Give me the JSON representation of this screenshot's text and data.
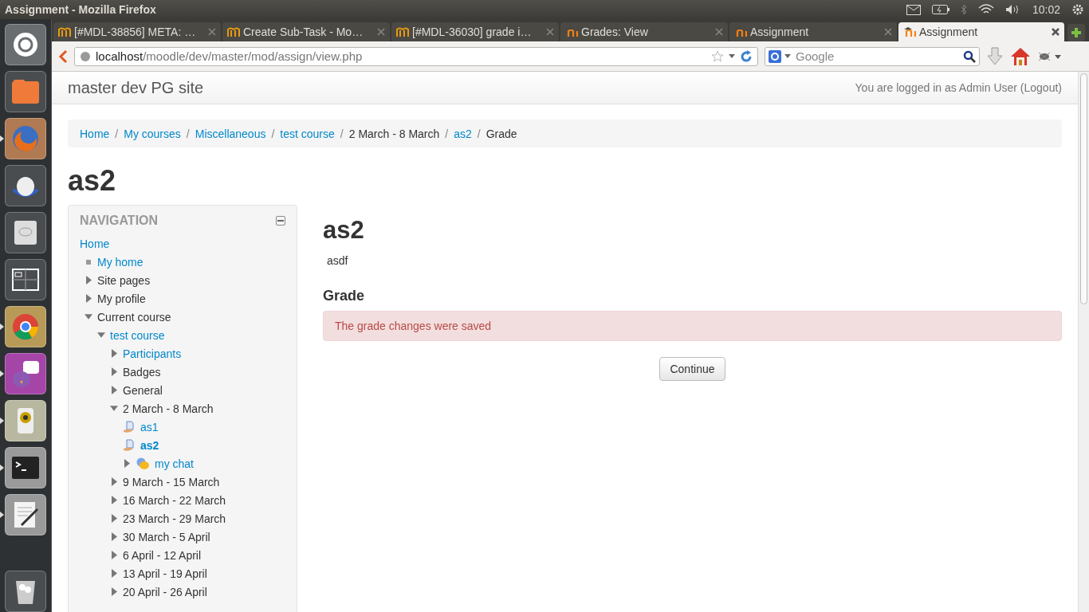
{
  "top_panel": {
    "title": "Assignment - Mozilla Firefox",
    "clock": "10:02"
  },
  "launcher": [
    {
      "kind": "dash",
      "running": false
    },
    {
      "kind": "folder",
      "running": false
    },
    {
      "kind": "firefox",
      "running": true
    },
    {
      "kind": "disc",
      "running": false
    },
    {
      "kind": "drive",
      "running": false
    },
    {
      "kind": "workspaces",
      "running": false
    },
    {
      "kind": "chrome",
      "running": true
    },
    {
      "kind": "chat",
      "running": true
    },
    {
      "kind": "speaker",
      "running": true
    },
    {
      "kind": "terminal",
      "running": true
    },
    {
      "kind": "editor",
      "running": true
    },
    {
      "kind": "trash",
      "running": false
    }
  ],
  "tabs": [
    {
      "label": "[#MDL-38856] META: …",
      "selected": false
    },
    {
      "label": "Create Sub-Task - Mo…",
      "selected": false
    },
    {
      "label": "[#MDL-36030] grade i…",
      "selected": false
    },
    {
      "label": "Grades: View",
      "selected": false
    },
    {
      "label": "Assignment",
      "selected": false
    },
    {
      "label": "Assignment",
      "selected": true
    }
  ],
  "address_bar": {
    "host": "localhost",
    "path": "/moodle/dev/master/mod/assign/view.php"
  },
  "search": {
    "placeholder": "Google"
  },
  "page": {
    "site_name": "master dev PG site",
    "login_info": "You are logged in as Admin User (Logout)",
    "breadcrumb_separator": "/",
    "breadcrumb": [
      {
        "label": "Home",
        "link": true
      },
      {
        "label": "My courses",
        "link": true
      },
      {
        "label": "Miscellaneous",
        "link": true
      },
      {
        "label": "test course",
        "link": true
      },
      {
        "label": "2 March - 8 March",
        "link": false
      },
      {
        "label": "as2",
        "link": true
      },
      {
        "label": "Grade",
        "link": false
      }
    ],
    "page_title": "as2",
    "navigation": {
      "title": "NAVIGATION",
      "items": [
        {
          "label": "Home",
          "kind": "link",
          "children": [
            {
              "label": "My home",
              "kind": "bullet",
              "link": true
            },
            {
              "label": "Site pages",
              "kind": "branch",
              "expanded": false,
              "link": false
            },
            {
              "label": "My profile",
              "kind": "branch",
              "expanded": false,
              "link": false
            },
            {
              "label": "Current course",
              "kind": "branch",
              "expanded": true,
              "link": false,
              "children": [
                {
                  "label": "test course",
                  "kind": "branch",
                  "expanded": true,
                  "link": true,
                  "children": [
                    {
                      "label": "Participants",
                      "kind": "branch",
                      "expanded": false,
                      "link": true
                    },
                    {
                      "label": "Badges",
                      "kind": "branch",
                      "expanded": false,
                      "link": false
                    },
                    {
                      "label": "General",
                      "kind": "branch",
                      "expanded": false,
                      "link": false
                    },
                    {
                      "label": "2 March - 8 March",
                      "kind": "branch",
                      "expanded": true,
                      "link": false,
                      "children": [
                        {
                          "label": "as1",
                          "kind": "assignment",
                          "link": true,
                          "selected": false
                        },
                        {
                          "label": "as2",
                          "kind": "assignment",
                          "link": true,
                          "selected": true
                        },
                        {
                          "label": "my chat",
                          "kind": "chat",
                          "expanded": false,
                          "link": true,
                          "selected": false
                        }
                      ]
                    },
                    {
                      "label": "9 March - 15 March",
                      "kind": "branch",
                      "expanded": false,
                      "link": false
                    },
                    {
                      "label": "16 March - 22 March",
                      "kind": "branch",
                      "expanded": false,
                      "link": false
                    },
                    {
                      "label": "23 March - 29 March",
                      "kind": "branch",
                      "expanded": false,
                      "link": false
                    },
                    {
                      "label": "30 March - 5 April",
                      "kind": "branch",
                      "expanded": false,
                      "link": false
                    },
                    {
                      "label": "6 April - 12 April",
                      "kind": "branch",
                      "expanded": false,
                      "link": false
                    },
                    {
                      "label": "13 April - 19 April",
                      "kind": "branch",
                      "expanded": false,
                      "link": false
                    },
                    {
                      "label": "20 April - 26 April",
                      "kind": "branch",
                      "expanded": false,
                      "link": false
                    }
                  ]
                }
              ]
            }
          ]
        }
      ]
    },
    "main": {
      "heading": "as2",
      "description": "asdf",
      "section": "Grade",
      "alert": "The grade changes were saved",
      "button": "Continue"
    }
  }
}
